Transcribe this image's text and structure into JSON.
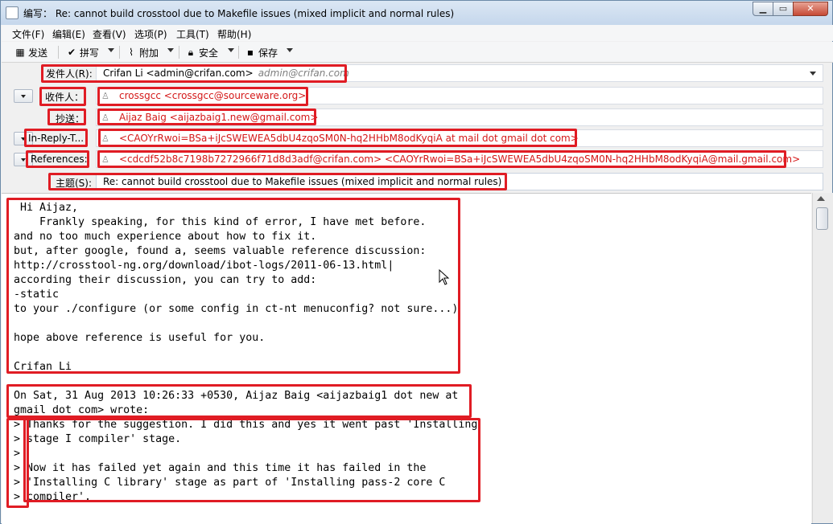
{
  "window": {
    "title": "编写： Re: cannot build crosstool due to Makefile issues (mixed implicit and normal rules)",
    "minimize": "▁",
    "maximize": "▭",
    "close": "✕"
  },
  "menubar": {
    "items": [
      {
        "label": "文件(F)"
      },
      {
        "label": "编辑(E)"
      },
      {
        "label": "查看(V)"
      },
      {
        "label": "选项(P)"
      },
      {
        "label": "工具(T)"
      },
      {
        "label": "帮助(H)"
      }
    ]
  },
  "toolbar": {
    "send": "发送",
    "spell": "拼写",
    "attach": "附加",
    "security": "安全",
    "save": "保存"
  },
  "header": {
    "from_label": "发件人(R):",
    "from_value": "Crifan Li <admin@crifan.com>",
    "from_hint": "admin@crifan.com",
    "to_label": "收件人：",
    "to_value": "crossgcc <crossgcc@sourceware.org>",
    "cc_label": "抄送：",
    "cc_value": "Aijaz Baig <aijazbaig1.new@gmail.com>",
    "inreplyto_label": "In-Reply-T...",
    "inreplyto_value": "<CAOYrRwoi=BSa+iJcSWEWEA5dbU4zqoSM0N-hq2HHbM8odKyqiA at mail dot gmail dot com>",
    "references_label": "References:",
    "references_value": "<cdcdf52b8c7198b7272966f71d8d3adf@crifan.com> <CAOYrRwoi=BSa+iJcSWEWEA5dbU4zqoSM0N-hq2HHbM8odKyqiA@mail.gmail.com>",
    "subject_label": "主题(S):",
    "subject_value": "Re: cannot build crosstool due to Makefile issues (mixed implicit and normal rules)"
  },
  "body": {
    "text": " Hi Aijaz,\n    Frankly speaking, for this kind of error, I have met before.\nand no too much experience about how to fix it.\nbut, after google, found a, seems valuable reference discussion:\nhttp://crosstool-ng.org/download/ibot-logs/2011-06-13.html|\naccording their discussion, you can try to add:\n-static\nto your ./configure (or some config in ct-nt menuconfig? not sure...)\n\nhope above reference is useful for you.\n\nCrifan Li\n\nOn Sat, 31 Aug 2013 10:26:33 +0530, Aijaz Baig <aijazbaig1 dot new at\ngmail dot com> wrote:\n> Thanks for the suggestion. I did this and yes it went past 'Installing\n> stage I compiler' stage.\n>\n> Now it has failed yet again and this time it has failed in the\n> 'Installing C library' stage as part of 'Installing pass-2 core C\n> compiler'."
  },
  "colors": {
    "annotation": "#e01c24",
    "address": "#d41818"
  }
}
